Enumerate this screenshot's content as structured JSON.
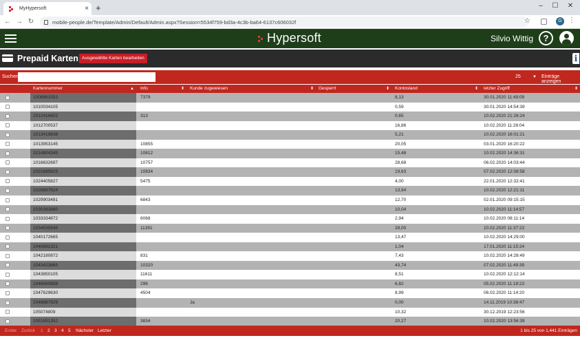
{
  "browser": {
    "tab_title": "MyHypersoft",
    "tab_close": "×",
    "new_tab": "+",
    "url": "mobile-people.de/Template/Admin/Default/Admin.aspx?Session=5534f759-bd3a-4c3b-ba64-6137c606032f",
    "profile_initial": "G",
    "window_minimize": "–",
    "window_maximize": "☐",
    "window_close": "✕"
  },
  "header": {
    "brand": "Hypersoft",
    "user_name": "Silvio Wittig",
    "help_glyph": "?"
  },
  "page": {
    "title": "Prepaid Karten",
    "edit_button": "Ausgewählte Karten bearbeiten",
    "info_glyph": "i"
  },
  "search": {
    "label": "Suchen",
    "value": "",
    "page_size": "25",
    "page_size_label": "Einträge anzeigen"
  },
  "table": {
    "columns": {
      "kartennummer": "Kartennummer",
      "info": "Info",
      "kunde": "Kunde zugewiesen",
      "gesperrt": "Gesperrt",
      "kontostand": "Kontostand",
      "zugriff": "letzter Zugriff"
    },
    "rows": [
      {
        "nr": "1008863353",
        "info": "7379",
        "kunde": "",
        "kontostand": "8,13",
        "zugriff": "30.01.2020 11:49:09"
      },
      {
        "nr": "1010034105",
        "info": "",
        "kunde": "",
        "kontostand": "0,59",
        "zugriff": "30.01.2020 14:54:39"
      },
      {
        "nr": "1012416602",
        "info": "313",
        "kunde": "",
        "kontostand": "0,65",
        "zugriff": "10.02.2020 21:26:24"
      },
      {
        "nr": "1012700537",
        "info": "",
        "kunde": "",
        "kontostand": "16,86",
        "zugriff": "10.02.2020 11:28:04"
      },
      {
        "nr": "1013419838",
        "info": "",
        "kunde": "",
        "kontostand": "5,21",
        "zugriff": "10.02.2020 16:01:21"
      },
      {
        "nr": "1013953145",
        "info": "10855",
        "kunde": "",
        "kontostand": "20,05",
        "zugriff": "03.01.2020 16:20:22"
      },
      {
        "nr": "1014804345",
        "info": "10812",
        "kunde": "",
        "kontostand": "15,48",
        "zugriff": "10.02.2020 14:36:31"
      },
      {
        "nr": "1016632697",
        "info": "10757",
        "kunde": "",
        "kontostand": "28,68",
        "zugriff": "06.02.2020 14:03:44"
      },
      {
        "nr": "1021685625",
        "info": "10834",
        "kunde": "",
        "kontostand": "19,63",
        "zugriff": "07.02.2020 12:08:58"
      },
      {
        "nr": "1024405827",
        "info": "5475",
        "kunde": "",
        "kontostand": "4,00",
        "zugriff": "22.01.2020 12:32:41"
      },
      {
        "nr": "1029697624",
        "info": "",
        "kunde": "",
        "kontostand": "13,94",
        "zugriff": "10.02.2020 12:21:11"
      },
      {
        "nr": "1029903481",
        "info": "6843",
        "kunde": "",
        "kontostand": "12,70",
        "zugriff": "02.01.2020 09:15:15"
      },
      {
        "nr": "1030383880",
        "info": "",
        "kunde": "",
        "kontostand": "10,04",
        "zugriff": "10.02.2020 11:14:57"
      },
      {
        "nr": "1033334872",
        "info": "6068",
        "kunde": "",
        "kontostand": "2,94",
        "zugriff": "10.02.2020 08:11:14"
      },
      {
        "nr": "1034535545",
        "info": "11391",
        "kunde": "",
        "kontostand": "28,00",
        "zugriff": "10.02.2020 11:37:23"
      },
      {
        "nr": "1040172665",
        "info": "",
        "kunde": "",
        "kontostand": "13,47",
        "zugriff": "10.02.2020 14:29:00"
      },
      {
        "nr": "1040691321",
        "info": "",
        "kunde": "",
        "kontostand": "1,04",
        "zugriff": "17.01.2020 11:15:24"
      },
      {
        "nr": "1042180872",
        "info": "831",
        "kunde": "",
        "kontostand": "7,43",
        "zugriff": "10.02.2020 14:28:49"
      },
      {
        "nr": "1043423865",
        "info": "10320",
        "kunde": "",
        "kontostand": "43,74",
        "zugriff": "07.02.2020 11:49:39"
      },
      {
        "nr": "1043850105",
        "info": "11611",
        "kunde": "",
        "kontostand": "8,51",
        "zugriff": "10.02.2020 12:12:14"
      },
      {
        "nr": "1046560858",
        "info": "296",
        "kunde": "",
        "kontostand": "6,82",
        "zugriff": "05.02.2020 11:18:23"
      },
      {
        "nr": "1047629630",
        "info": "4504",
        "kunde": "",
        "kontostand": "8,99",
        "zugriff": "06.02.2020 11:14:20"
      },
      {
        "nr": "1048887929",
        "info": "",
        "kunde": "Ja",
        "kontostand": "0,00",
        "zugriff": "14.11.2019 10:38:47"
      },
      {
        "nr": "105074809",
        "info": "",
        "kunde": "",
        "kontostand": "10,32",
        "zugriff": "30.12.2019 12:23:56"
      },
      {
        "nr": "1051851352",
        "info": "3834",
        "kunde": "",
        "kontostand": "20,27",
        "zugriff": "10.02.2020 13:56:39"
      }
    ]
  },
  "pagination": {
    "first": "Erster",
    "prev": "Zurück",
    "pages": [
      "1",
      "2",
      "3",
      "4",
      "5"
    ],
    "next": "Nächster",
    "last": "Letzter",
    "summary": "1 bis 25 von 1,441 Einträgen"
  },
  "colors": {
    "header_green": "#1e3e1a",
    "accent_red": "#c0271e",
    "title_dark": "#2b2b2b"
  }
}
